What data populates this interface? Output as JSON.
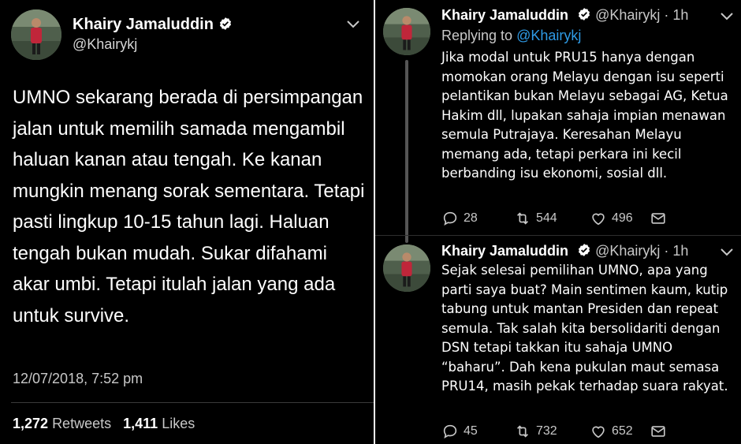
{
  "colors": {
    "background": "#000000",
    "link": "#2f9be6",
    "muted": "#c8c8c8",
    "verified": "#ffffff"
  },
  "main_tweet": {
    "author_name": "Khairy Jamaluddin",
    "author_handle": "@Khairykj",
    "text": "UMNO sekarang berada di persimpangan jalan untuk memilih samada mengambil haluan kanan atau tengah. Ke kanan mungkin menang sorak sementara. Tetapi pasti lingkup 10-15 tahun lagi. Haluan tengah bukan mudah. Sukar difahami akar umbi. Tetapi itulah jalan yang ada untuk survive.",
    "timestamp": "12/07/2018, 7:52 pm",
    "retweets_count": "1,272",
    "retweets_label": "Retweets",
    "likes_count": "1,411",
    "likes_label": "Likes",
    "icons": [
      "verified-badge-icon",
      "chevron-down-icon"
    ]
  },
  "replies": [
    {
      "author_name": "Khairy Jamaluddin",
      "author_handle": "@Khairykj",
      "time": "· 1h",
      "replying_to_label": "Replying to",
      "replying_to_handle": "@Khairykj",
      "text": "Jika modal untuk PRU15 hanya dengan momokan orang Melayu dengan isu seperti pelantikan bukan Melayu sebagai AG, Ketua Hakim dll, lupakan sahaja impian menawan semula Putrajaya. Keresahan Melayu memang ada, tetapi perkara ini kecil berbanding isu ekonomi, sosial dll.",
      "reply_count": "28",
      "retweet_count": "544",
      "like_count": "496"
    },
    {
      "author_name": "Khairy Jamaluddin",
      "author_handle": "@Khairykj",
      "time": "· 1h",
      "text": "Sejak selesai pemilihan UMNO, apa yang parti saya buat? Main sentimen kaum, kutip tabung untuk mantan Presiden dan repeat semula. Tak salah kita bersolidariti dengan DSN tetapi takkan itu sahaja UMNO “baharu”. Dah kena pukulan maut semasa PRU14, masih pekak terhadap suara rakyat.",
      "reply_count": "45",
      "retweet_count": "732",
      "like_count": "652"
    }
  ]
}
